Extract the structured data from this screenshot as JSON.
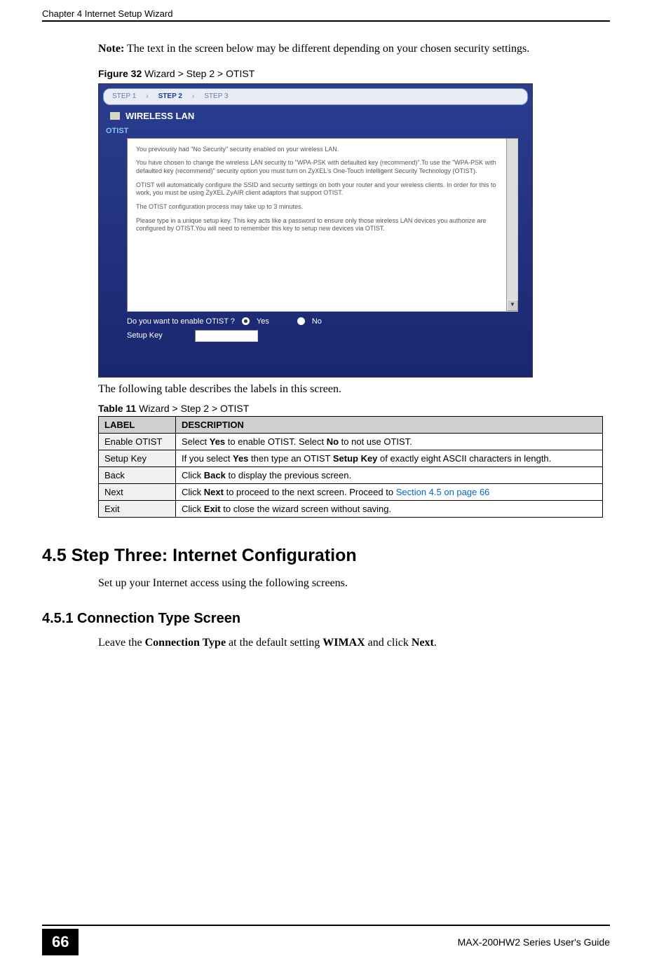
{
  "header": {
    "chapter": "Chapter 4 Internet Setup Wizard"
  },
  "note": {
    "label": "Note:",
    "text": " The text in the screen below may be different depending on your chosen security settings."
  },
  "figure": {
    "label": "Figure 32",
    "title": "   Wizard > Step 2 > OTIST"
  },
  "screenshot": {
    "step1": "STEP 1",
    "step2": "STEP 2",
    "step3": "STEP 3",
    "arrow": "›",
    "section": "WIRELESS LAN",
    "otist": "OTIST",
    "para1": "You previously had \"No Security\" security enabled on your wireless LAN.",
    "para2": "You have chosen to change the wireless LAN security to \"WPA-PSK with defaulted key (recommend)\".To use the \"WPA-PSK with defaulted key (recommend)\" security option you must turn on ZyXEL's One-Touch Intelligent Security Technology (OTIST).",
    "para3": "OTIST will automatically configure the SSID and security settings on both your router and your wireless clients. In order for this to work, you must be using ZyXEL ZyAIR client adaptors that support OTIST.",
    "para4": "The OTIST configuration process may take up to 3 minutes.",
    "para5": "Please type in a unique setup key. This key acts like a password to ensure only those wireless LAN devices you authorize are configured by OTIST.You will need to remember this key to setup new devices via OTIST.",
    "enable_q": "Do you want to enable OTIST ?",
    "yes": "Yes",
    "no": "No",
    "setup_key": "Setup Key"
  },
  "table_intro": "The following table describes the labels in this screen.",
  "table": {
    "caption_label": "Table 11",
    "caption_title": "   Wizard > Step 2 > OTIST",
    "col1": "LABEL",
    "col2": "DESCRIPTION",
    "rows": [
      {
        "label": "Enable OTIST",
        "desc_prefix": "Select ",
        "desc_b1": "Yes",
        "desc_mid": " to enable OTIST. Select ",
        "desc_b2": "No",
        "desc_suffix": " to not use OTIST."
      },
      {
        "label": "Setup Key",
        "desc_prefix": "If you select ",
        "desc_b1": "Yes",
        "desc_mid": " then type an OTIST ",
        "desc_b2": "Setup Key",
        "desc_suffix": " of exactly eight ASCII characters in length."
      },
      {
        "label": "Back",
        "desc_prefix": "Click ",
        "desc_b1": "Back",
        "desc_suffix": " to display the previous screen."
      },
      {
        "label": "Next",
        "desc_prefix": "Click ",
        "desc_b1": "Next",
        "desc_suffix": " to proceed to the next screen. Proceed to ",
        "desc_link": "Section 4.5 on page 66"
      },
      {
        "label": "Exit",
        "desc_prefix": "Click ",
        "desc_b1": "Exit",
        "desc_suffix": " to close the wizard screen without saving."
      }
    ]
  },
  "section45": {
    "heading": "4.5  Step Three: Internet Configuration",
    "text": "Set up your Internet access using the following screens."
  },
  "section451": {
    "heading": "4.5.1  Connection Type Screen",
    "text_prefix": "Leave the ",
    "text_b1": "Connection Type",
    "text_mid": " at the default setting ",
    "text_b2": "WIMAX",
    "text_mid2": " and click ",
    "text_b3": "Next",
    "text_suffix": "."
  },
  "footer": {
    "page": "66",
    "guide": "MAX-200HW2 Series User's Guide"
  }
}
